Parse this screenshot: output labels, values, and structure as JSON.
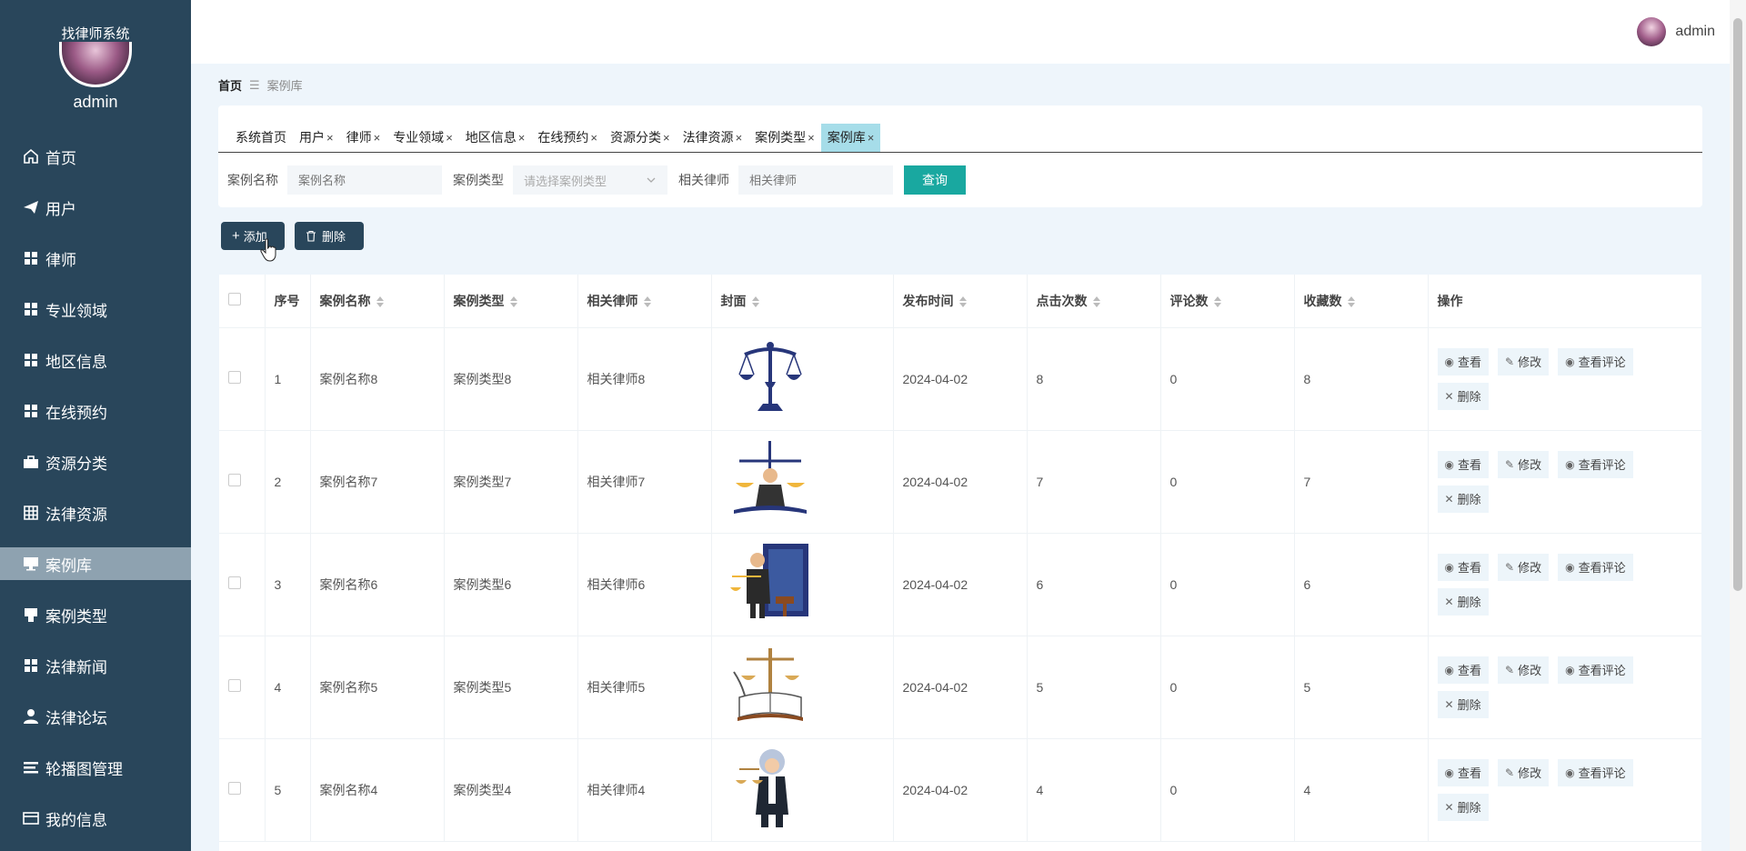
{
  "app": {
    "title": "找律师系统",
    "user": "admin"
  },
  "menu": [
    {
      "label": "首页",
      "icon": "home-icon"
    },
    {
      "label": "用户",
      "icon": "paper-plane-icon"
    },
    {
      "label": "律师",
      "icon": "grid-icon"
    },
    {
      "label": "专业领域",
      "icon": "grid-icon"
    },
    {
      "label": "地区信息",
      "icon": "grid-icon"
    },
    {
      "label": "在线预约",
      "icon": "grid-icon"
    },
    {
      "label": "资源分类",
      "icon": "briefcase-icon"
    },
    {
      "label": "法律资源",
      "icon": "table-icon"
    },
    {
      "label": "案例库",
      "icon": "monitor-icon",
      "active": true
    },
    {
      "label": "案例类型",
      "icon": "flag-icon"
    },
    {
      "label": "法律新闻",
      "icon": "grid-icon"
    },
    {
      "label": "法律论坛",
      "icon": "user-icon"
    },
    {
      "label": "轮播图管理",
      "icon": "list-icon"
    },
    {
      "label": "我的信息",
      "icon": "card-icon"
    }
  ],
  "header": {
    "user": "admin"
  },
  "breadcrumb": {
    "home": "首页",
    "separator": "☰",
    "current": "案例库"
  },
  "tabs": [
    {
      "label": "系统首页",
      "closable": false
    },
    {
      "label": "用户",
      "closable": true
    },
    {
      "label": "律师",
      "closable": true
    },
    {
      "label": "专业领域",
      "closable": true
    },
    {
      "label": "地区信息",
      "closable": true
    },
    {
      "label": "在线预约",
      "closable": true
    },
    {
      "label": "资源分类",
      "closable": true
    },
    {
      "label": "法律资源",
      "closable": true
    },
    {
      "label": "案例类型",
      "closable": true
    },
    {
      "label": "案例库",
      "closable": true,
      "active": true
    }
  ],
  "search": {
    "name_label": "案例名称",
    "name_placeholder": "案例名称",
    "type_label": "案例类型",
    "type_placeholder": "请选择案例类型",
    "lawyer_label": "相关律师",
    "lawyer_placeholder": "相关律师",
    "query_button": "查询"
  },
  "actions": {
    "add": "添加",
    "delete": "删除"
  },
  "table": {
    "columns": [
      "序号",
      "案例名称",
      "案例类型",
      "相关律师",
      "封面",
      "发布时间",
      "点击次数",
      "评论数",
      "收藏数",
      "操作"
    ],
    "row_actions": {
      "view": "查看",
      "edit": "修改",
      "view_comments": "查看评论",
      "delete": "删除"
    },
    "rows": [
      {
        "index": "1",
        "name": "案例名称8",
        "type": "案例类型8",
        "lawyer": "相关律师8",
        "cover": "scales-of-justice",
        "date": "2024-04-02",
        "clicks": "8",
        "comments": "0",
        "favorites": "8"
      },
      {
        "index": "2",
        "name": "案例名称7",
        "type": "案例类型7",
        "lawyer": "相关律师7",
        "cover": "lawyer-with-scales",
        "date": "2024-04-02",
        "clicks": "7",
        "comments": "0",
        "favorites": "7"
      },
      {
        "index": "3",
        "name": "案例名称6",
        "type": "案例类型6",
        "lawyer": "相关律师6",
        "cover": "lawyer-with-gavel",
        "date": "2024-04-02",
        "clicks": "6",
        "comments": "0",
        "favorites": "6"
      },
      {
        "index": "4",
        "name": "案例名称5",
        "type": "案例类型5",
        "lawyer": "相关律师5",
        "cover": "scales-and-book",
        "date": "2024-04-02",
        "clicks": "5",
        "comments": "0",
        "favorites": "5"
      },
      {
        "index": "5",
        "name": "案例名称4",
        "type": "案例类型4",
        "lawyer": "相关律师4",
        "cover": "judge-with-scales",
        "date": "2024-04-02",
        "clicks": "4",
        "comments": "0",
        "favorites": "4"
      }
    ]
  },
  "colors": {
    "sidebar": "#29465b",
    "active_menu": "#8ea2b0",
    "query_button": "#19a8a0",
    "active_tab": "#a6dde9"
  }
}
